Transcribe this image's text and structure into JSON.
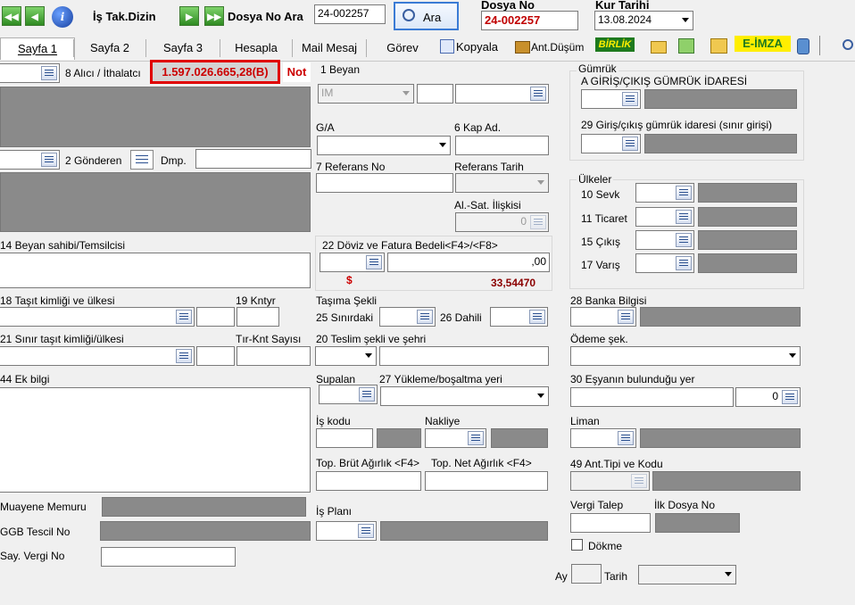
{
  "toolbar": {
    "first_label": "◀◀",
    "prev_label": "◀",
    "info_label": "i",
    "is_tak_dizin": "İş Tak.Dizin",
    "next_label": "▶",
    "last_label": "▶▶",
    "dosya_no_ara_label": "Dosya No Ara",
    "dosya_no_ara_value": "24-002257",
    "ara_button": "Ara",
    "dosya_no_title": "Dosya No",
    "dosya_no_value": "24-002257",
    "kur_tarihi_title": "Kur Tarihi",
    "kur_tarihi_value": "13.08.2024"
  },
  "tabs": [
    "Sayfa 1",
    "Sayfa 2",
    "Sayfa 3",
    "Hesapla",
    "Mail Mesaj",
    "Görev"
  ],
  "toolbar2": {
    "kopyala": "Kopyala",
    "ant_dusum": "Ant.Düşüm",
    "birlik": "BİRLİK",
    "e_imza": "E-İMZA"
  },
  "left": {
    "alici_label": "8 Alıcı / İthalatcı",
    "amount": "1.597.026.665,28(B)",
    "not_label": "Not",
    "gonderen_label": "2 Gönderen",
    "dmp_label": "Dmp.",
    "beyan_sahibi_label": "14 Beyan sahibi/Temsilcisi",
    "tasit_label": "18 Taşıt kimliği ve ülkesi",
    "kntyr_label": "19 Kntyr",
    "sinir_tasit_label": "21 Sınır taşıt kimliği/ülkesi",
    "tir_knt_label": "Tır-Knt Sayısı",
    "ek_bilgi_label": "44 Ek bilgi",
    "muayene_label": "Muayene Memuru",
    "ggb_label": "GGB Tescil No",
    "say_vergi_label": "Say. Vergi No"
  },
  "middle": {
    "beyan_label": "1 Beyan",
    "beyan_value": "IM",
    "ga_label": "G/A",
    "kap_label": "6 Kap Ad.",
    "referans_no_label": "7 Referans No",
    "referans_tarih_label": "Referans Tarih",
    "al_sat_label": "Al.-Sat. İlişkisi",
    "al_sat_value": "0",
    "doviz_label": "22 Döviz ve Fatura Bedeli<F4>/<F8>",
    "doviz_amount": ",00",
    "currency_symbol": "$",
    "rate": "33,54470",
    "tasima_label": "Taşıma Şekli",
    "sinirdaki_label": "25 Sınırdaki",
    "dahili_label": "26 Dahili",
    "teslim_label": "20 Teslim şekli ve şehri",
    "supalan_label": "Supalan",
    "yukleme_label": "27 Yükleme/boşaltma yeri",
    "is_kodu_label": "İş kodu",
    "nakliye_label": "Nakliye",
    "brut_label": "Top. Brüt Ağırlık <F4>",
    "net_label": "Top. Net Ağırlık <F4>",
    "is_plani_label": "İş Planı"
  },
  "right": {
    "gumruk_title": "Gümrük",
    "giris_label": "A GİRİŞ/ÇIKIŞ GÜMRÜK İDARESİ",
    "sinir_giris_label": "29 Giriş/çıkış gümrük idaresi (sınır girişi)",
    "ulkeler_title": "Ülkeler",
    "sevk_label": "10 Sevk",
    "ticaret_label": "11 Ticaret",
    "cikis_label": "15 Çıkış",
    "varis_label": "17 Varış",
    "banka_label": "28 Banka Bilgisi",
    "odeme_label": "Ödeme şek.",
    "esya_label": "30 Eşyanın bulunduğu yer",
    "esya_value": "0",
    "liman_label": "Liman",
    "ant_tipi_label": "49 Ant.Tipi ve Kodu",
    "vergi_talep_label": "Vergi Talep",
    "ilk_dosya_label": "İlk Dosya No",
    "dokme_label": "Dökme",
    "ay_label": "Ay",
    "tarih_label": "Tarih"
  },
  "colors": {
    "amount_text": "#cc0000",
    "amount_border": "#e00000",
    "birlik_bg": "#1e7a1e",
    "eimza_bg": "#ffee00"
  }
}
